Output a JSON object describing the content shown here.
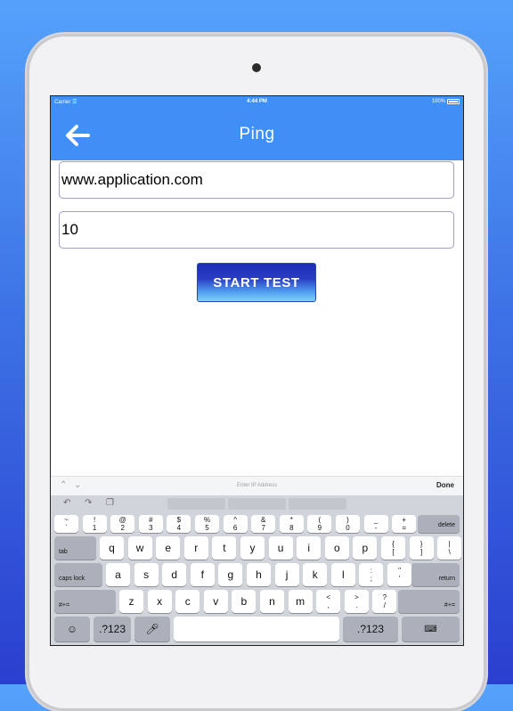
{
  "status_bar": {
    "carrier": "Carrier",
    "time": "4:44 PM",
    "battery": "100%"
  },
  "nav": {
    "title": "Ping"
  },
  "form": {
    "host_value": "www.application.com",
    "count_value": "10",
    "start_label": "START TEST"
  },
  "keyboard_toolbar": {
    "hint": "Enter IP Address",
    "done": "Done"
  },
  "keyboard": {
    "row0": [
      {
        "top": "~",
        "bottom": "`"
      },
      {
        "top": "!",
        "bottom": "1"
      },
      {
        "top": "@",
        "bottom": "2"
      },
      {
        "top": "#",
        "bottom": "3"
      },
      {
        "top": "$",
        "bottom": "4"
      },
      {
        "top": "%",
        "bottom": "5"
      },
      {
        "top": "^",
        "bottom": "6"
      },
      {
        "top": "&",
        "bottom": "7"
      },
      {
        "top": "*",
        "bottom": "8"
      },
      {
        "top": "(",
        "bottom": "9"
      },
      {
        "top": ")",
        "bottom": "0"
      },
      {
        "top": "_",
        "bottom": "-"
      },
      {
        "top": "+",
        "bottom": "="
      }
    ],
    "delete": "delete",
    "tab": "tab",
    "row1": [
      "q",
      "w",
      "e",
      "r",
      "t",
      "y",
      "u",
      "i",
      "o",
      "p"
    ],
    "row1_extra": [
      {
        "top": "{",
        "bottom": "["
      },
      {
        "top": "}",
        "bottom": "]"
      },
      {
        "top": "|",
        "bottom": "\\"
      }
    ],
    "caps": "caps lock",
    "row2": [
      "a",
      "s",
      "d",
      "f",
      "g",
      "h",
      "j",
      "k",
      "l"
    ],
    "row2_extra": [
      {
        "top": ":",
        "bottom": ";"
      },
      {
        "top": "\"",
        "bottom": "'"
      }
    ],
    "return": "return",
    "shift_left": "#+=",
    "row3": [
      "z",
      "x",
      "c",
      "v",
      "b",
      "n",
      "m"
    ],
    "row3_extra": [
      {
        "top": "<",
        "bottom": ","
      },
      {
        "top": ">",
        "bottom": "."
      },
      {
        "top": "?",
        "bottom": "/"
      }
    ],
    "shift_right": "#+=",
    "num_left": ".?123",
    "num_right": ".?123"
  }
}
